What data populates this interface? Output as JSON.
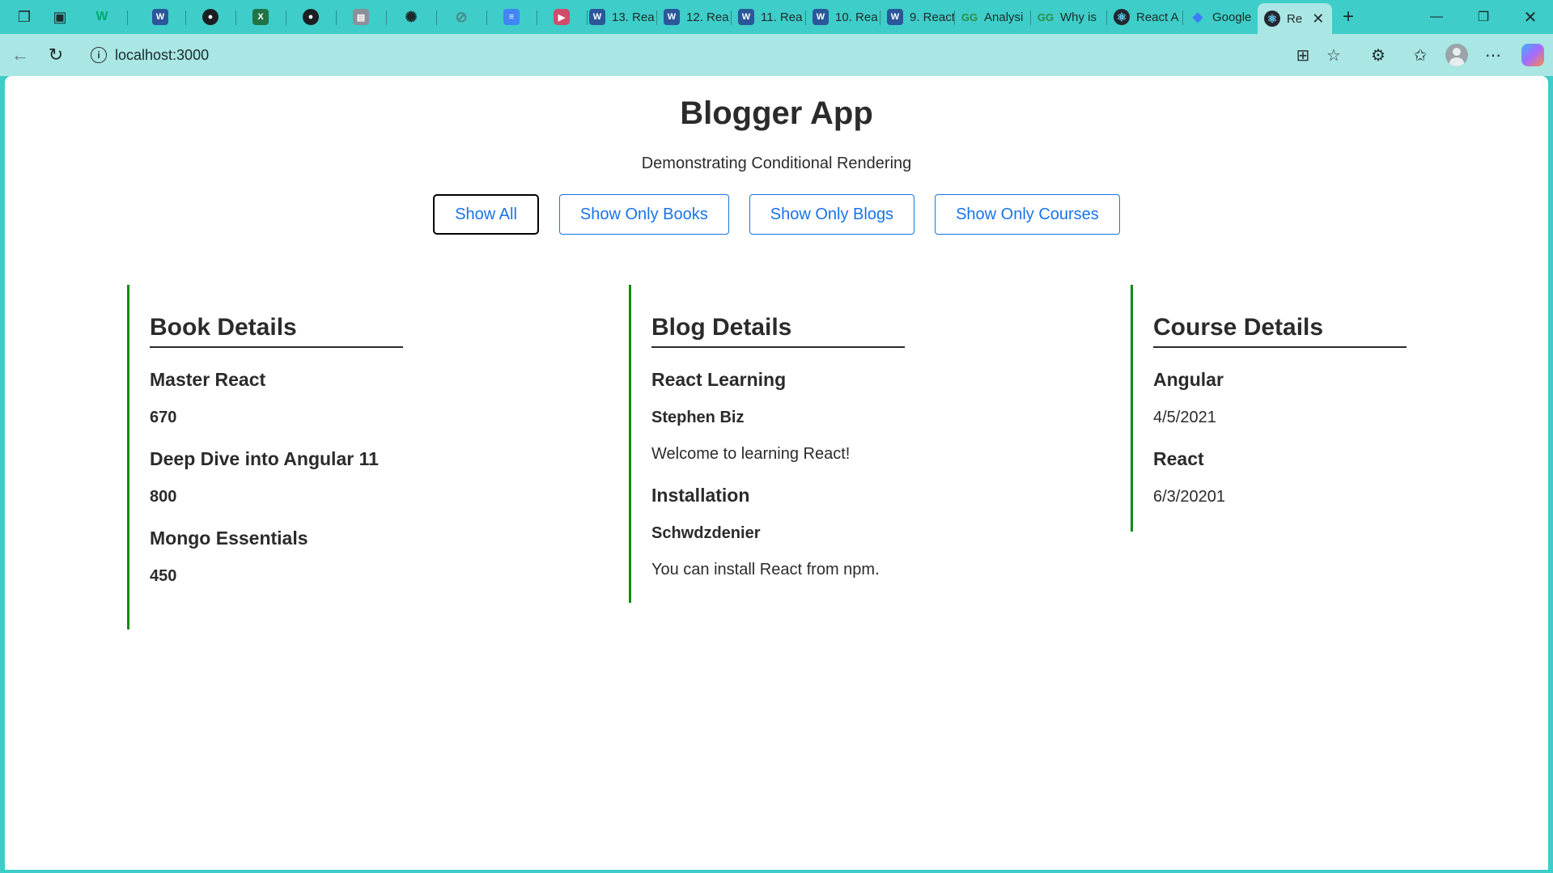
{
  "browser": {
    "tabs": [
      {
        "favicon": "w3",
        "title": ""
      },
      {
        "favicon": "word",
        "title": ""
      },
      {
        "favicon": "gh",
        "title": ""
      },
      {
        "favicon": "excel",
        "title": ""
      },
      {
        "favicon": "gh",
        "title": ""
      },
      {
        "favicon": "pdf",
        "title": ""
      },
      {
        "favicon": "gpt",
        "title": ""
      },
      {
        "favicon": "gpt",
        "title": ""
      },
      {
        "favicon": "docs",
        "title": ""
      },
      {
        "favicon": "yt",
        "title": ""
      },
      {
        "favicon": "word",
        "title": "13. Rea"
      },
      {
        "favicon": "word",
        "title": "12. Rea"
      },
      {
        "favicon": "word",
        "title": "11. Rea"
      },
      {
        "favicon": "word",
        "title": "10. Rea"
      },
      {
        "favicon": "word",
        "title": "9. React"
      },
      {
        "favicon": "gfg",
        "title": "Analysi"
      },
      {
        "favicon": "gfg",
        "title": "Why is"
      },
      {
        "favicon": "react",
        "title": "React A"
      },
      {
        "favicon": "gem",
        "title": "Google"
      },
      {
        "favicon": "react",
        "title": "Re",
        "active": true
      }
    ],
    "url": "localhost:3000",
    "icons": {
      "workspaces": "workspaces-icon",
      "tab_actions": "tab-actions-icon",
      "new_tab": "plus-icon",
      "minimize": "minimize-icon",
      "restore": "restore-icon",
      "close": "close-icon",
      "back": "back-arrow-icon",
      "refresh": "refresh-icon",
      "site_info": "info-icon",
      "app_available": "app-grid-icon",
      "favorite": "star-icon",
      "extensions": "puzzle-icon",
      "favorites": "favorites-icon",
      "profile": "profile-icon",
      "more": "more-icon",
      "copilot": "copilot-icon"
    }
  },
  "app": {
    "title": "Blogger App",
    "subtitle": "Demonstrating Conditional Rendering",
    "filters": [
      {
        "label": "Show All",
        "active": true
      },
      {
        "label": "Show Only Books",
        "active": false
      },
      {
        "label": "Show Only Blogs",
        "active": false
      },
      {
        "label": "Show Only Courses",
        "active": false
      }
    ],
    "books": {
      "heading": "Book Details",
      "items": [
        {
          "name": "Master React",
          "price": "670"
        },
        {
          "name": "Deep Dive into Angular 11",
          "price": "800"
        },
        {
          "name": "Mongo Essentials",
          "price": "450"
        }
      ]
    },
    "blogs": {
      "heading": "Blog Details",
      "items": [
        {
          "title": "React Learning",
          "author": "Stephen Biz",
          "content": "Welcome to learning React!"
        },
        {
          "title": "Installation",
          "author": "Schwdzdenier",
          "content": "You can install React from npm."
        }
      ]
    },
    "courses": {
      "heading": "Course Details",
      "items": [
        {
          "name": "Angular",
          "date": "4/5/2021"
        },
        {
          "name": "React",
          "date": "6/3/20201"
        }
      ]
    },
    "colors": {
      "accent_border": "#138a13",
      "button_blue": "#1a73e8",
      "browser_frame": "#3ecdc8",
      "toolbar": "#a9e6e4"
    }
  }
}
